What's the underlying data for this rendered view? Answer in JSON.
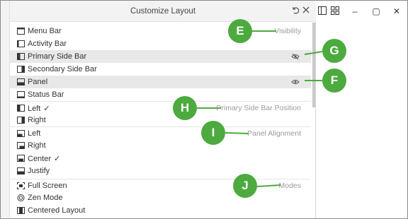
{
  "dialog": {
    "title": "Customize Layout",
    "reset_icon": "reset-icon",
    "close_icon": "close-icon"
  },
  "sections": {
    "visibility": "Visibility",
    "side_bar_position": "Primary Side Bar Position",
    "panel_alignment": "Panel Alignment",
    "modes": "Modes"
  },
  "items": {
    "menu_bar": "Menu Bar",
    "activity_bar": "Activity Bar",
    "primary_side_bar": "Primary Side Bar",
    "secondary_side_bar": "Secondary Side Bar",
    "panel": "Panel",
    "status_bar": "Status Bar",
    "sb_left": "Left",
    "sb_left_check": "✓",
    "sb_right": "Right",
    "pa_left": "Left",
    "pa_right": "Right",
    "pa_center": "Center",
    "pa_center_check": "✓",
    "pa_justify": "Justify",
    "full_screen": "Full Screen",
    "zen_mode": "Zen Mode",
    "centered_layout": "Centered Layout"
  },
  "callouts": {
    "E": "E",
    "F": "F",
    "G": "G",
    "H": "H",
    "I": "I",
    "J": "J"
  },
  "window_controls": {
    "minimize": "–",
    "maximize": "▢",
    "close": "✕"
  },
  "colors": {
    "callout_green": "#4caa3f",
    "highlight_row": "#e8e8e8",
    "section_gray": "#9a9a9a"
  }
}
